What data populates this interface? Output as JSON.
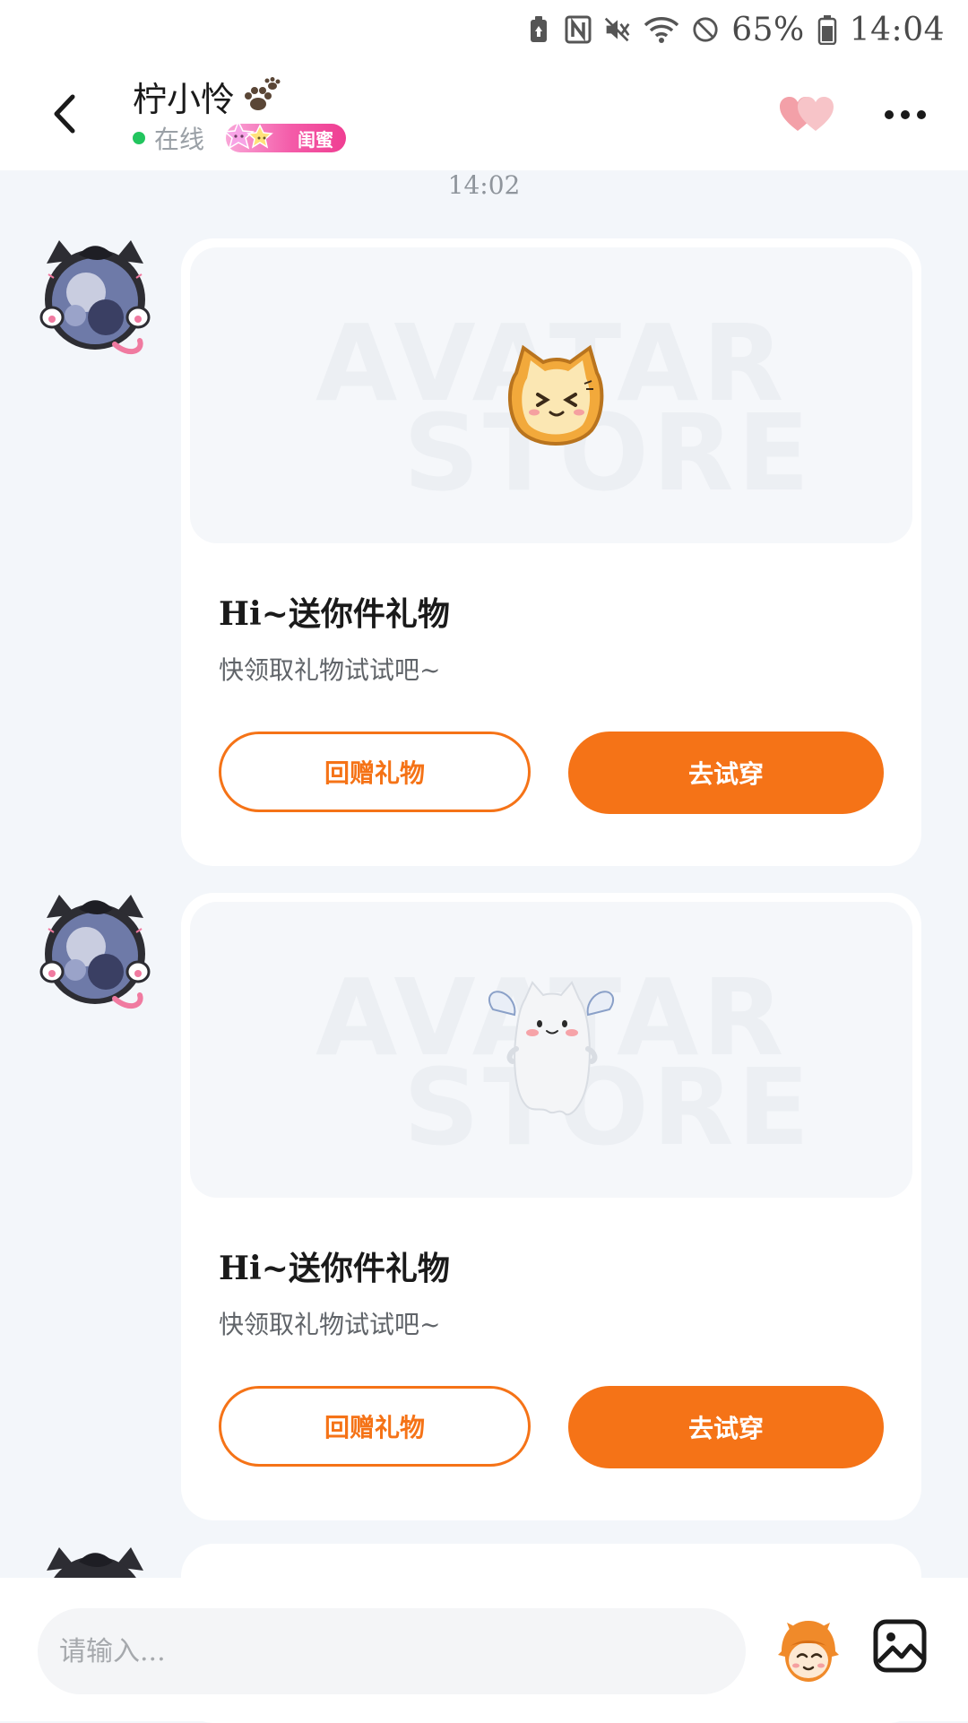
{
  "status_bar": {
    "battery_percent": "65%",
    "time": "14:04",
    "icons": [
      "battery-saver-icon",
      "nfc-icon",
      "mute-icon",
      "wifi-icon",
      "do-not-disturb-icon",
      "battery-icon"
    ]
  },
  "header": {
    "contact_name": "柠小怜",
    "presence_text": "在线",
    "relation_badge": "闺蜜",
    "icons": [
      "back-icon",
      "paw-icon",
      "hearts-icon",
      "more-icon"
    ]
  },
  "chat": {
    "timestamp": "14:02",
    "messages": [
      {
        "title": "Hi~送你件礼物",
        "subtitle": "快领取礼物试试吧~",
        "return_gift_label": "回赠礼物",
        "try_on_label": "去试穿",
        "watermark_line1": "AVATAR",
        "watermark_line2": "STORE",
        "gift_item": "toast-cat-icon"
      },
      {
        "title": "Hi~送你件礼物",
        "subtitle": "快领取礼物试试吧~",
        "return_gift_label": "回赠礼物",
        "try_on_label": "去试穿",
        "watermark_line1": "AVATAR",
        "watermark_line2": "STORE",
        "gift_item": "ghost-cat-icon"
      }
    ]
  },
  "input_bar": {
    "placeholder": "请输入...",
    "icons": [
      "mascot-icon",
      "image-icon"
    ]
  },
  "colors": {
    "accent": "#f57317",
    "background": "#f3f6fa",
    "online": "#22c55e",
    "badge": "#f45ba8"
  }
}
